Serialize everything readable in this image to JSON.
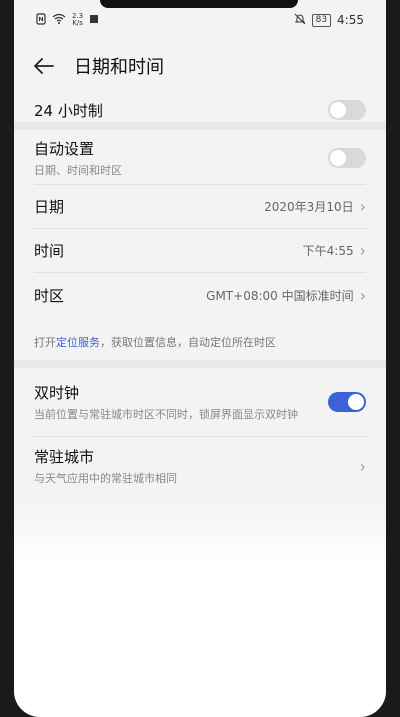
{
  "status": {
    "speed_value": "2.3",
    "speed_unit": "K/s",
    "battery": "83",
    "time": "4:55",
    "icons": [
      "nfc-icon",
      "wifi-icon",
      "notification-icon",
      "mute-icon"
    ]
  },
  "header": {
    "title": "日期和时间"
  },
  "rows": {
    "hour24": {
      "label": "24 小时制",
      "toggle": false
    },
    "auto": {
      "label": "自动设置",
      "sub": "日期、时间和时区",
      "toggle": false
    },
    "date": {
      "label": "日期",
      "value": "2020年3月10日"
    },
    "time": {
      "label": "时间",
      "value": "下午4:55"
    },
    "timezone": {
      "label": "时区",
      "value": "GMT+08:00 中国标准时间"
    }
  },
  "location_note": {
    "prefix": "打开",
    "link": "定位服务",
    "suffix": "，获取位置信息，自动定位所在时区"
  },
  "dual_clock": {
    "label": "双时钟",
    "sub": "当前位置与常驻城市时区不同时，锁屏界面显示双时钟",
    "toggle": true
  },
  "home_city": {
    "label": "常驻城市",
    "sub": "与天气应用中的常驻城市相同"
  },
  "colors": {
    "accent": "#3b62d8",
    "background": "#f3f3f3"
  }
}
